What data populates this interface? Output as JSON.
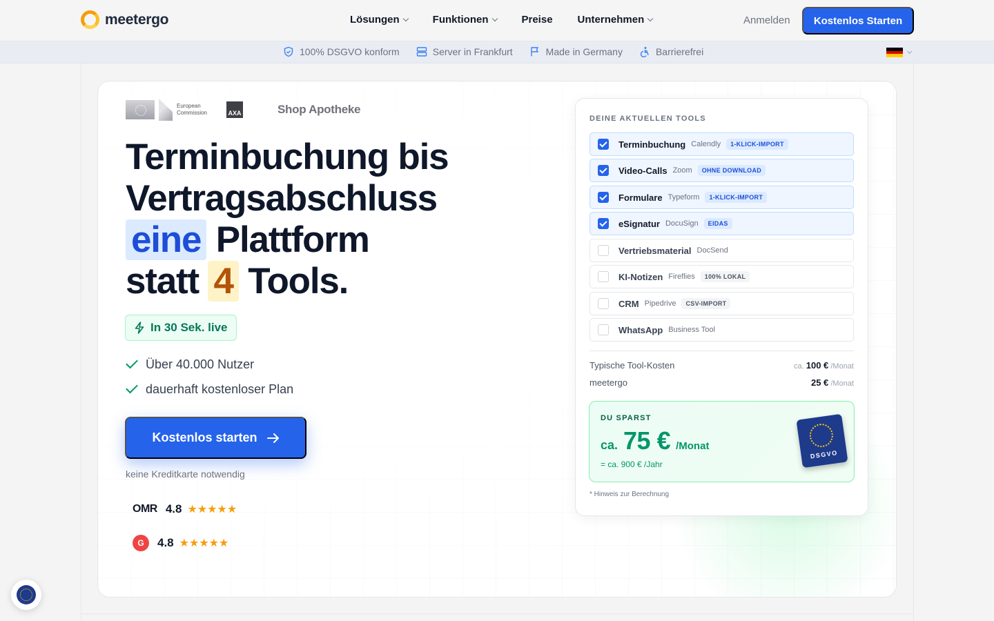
{
  "brand": {
    "name": "meetergo"
  },
  "nav": {
    "items": [
      {
        "label": "Lösungen",
        "has_dropdown": true
      },
      {
        "label": "Funktionen",
        "has_dropdown": true
      },
      {
        "label": "Preise",
        "has_dropdown": false
      },
      {
        "label": "Unternehmen",
        "has_dropdown": true
      }
    ],
    "login_label": "Anmelden",
    "cta_label": "Kostenlos Starten"
  },
  "trust_bar": {
    "items": [
      {
        "label": "100% DSGVO konform",
        "icon": "shield-icon"
      },
      {
        "label": "Server in Frankfurt",
        "icon": "server-icon"
      },
      {
        "label": "Made in Germany",
        "icon": "flag-icon"
      },
      {
        "label": "Barrierefrei",
        "icon": "accessibility-icon"
      }
    ],
    "language_flag": "de",
    "flag_colors": [
      "#000000",
      "#dd0000",
      "#ffce00"
    ]
  },
  "hero": {
    "logos": {
      "ec_line1": "European",
      "ec_line2": "Commission",
      "axa": "AXA",
      "shop": "Shop Apotheke"
    },
    "headline": {
      "line1": "Terminbuchung bis",
      "line2": "Vertragsabschluss",
      "line3_highlight": "eine",
      "line3_rest": "Plattform",
      "line4_start": "statt",
      "line4_highlight": "4",
      "line4_rest": "Tools."
    },
    "live_badge": "In 30 Sek. live",
    "checks": [
      "Über 40.000 Nutzer",
      "dauerhaft kostenloser Plan"
    ],
    "cta_label": "Kostenlos starten",
    "no_credit_card": "keine Kreditkarte notwendig",
    "ratings": [
      {
        "source": "OMR",
        "score": "4.8",
        "stars": "★★★★★"
      },
      {
        "source": "G2",
        "score": "4.8",
        "stars": "★★★★★"
      }
    ]
  },
  "tools_panel": {
    "title": "DEINE AKTUELLEN TOOLS",
    "tools": [
      {
        "name": "Terminbuchung",
        "vendor": "Calendly",
        "badge": "1-KLICK-IMPORT",
        "checked": true
      },
      {
        "name": "Video-Calls",
        "vendor": "Zoom",
        "badge": "OHNE DOWNLOAD",
        "checked": true
      },
      {
        "name": "Formulare",
        "vendor": "Typeform",
        "badge": "1-KLICK-IMPORT",
        "checked": true
      },
      {
        "name": "eSignatur",
        "vendor": "DocuSign",
        "badge": "EIDAS",
        "checked": true
      },
      {
        "name": "Vertriebsmaterial",
        "vendor": "DocSend",
        "badge": "",
        "checked": false
      },
      {
        "name": "KI-Notizen",
        "vendor": "Fireflies",
        "badge": "100% LOKAL",
        "checked": false
      },
      {
        "name": "CRM",
        "vendor": "Pipedrive",
        "badge": "CSV-IMPORT",
        "checked": false
      },
      {
        "name": "WhatsApp",
        "vendor": "Business Tool",
        "badge": "",
        "checked": false
      }
    ],
    "costs": {
      "typical_label": "Typische Tool-Kosten",
      "typical_prefix": "ca.",
      "typical_value": "100 €",
      "typical_unit": "/Monat",
      "meetergo_label": "meetergo",
      "meetergo_value": "25 €",
      "meetergo_unit": "/Monat"
    },
    "savings": {
      "label": "DU SPARST",
      "prefix": "ca.",
      "amount": "75 €",
      "unit": "/Monat",
      "yearly": "= ca. 900 € /Jahr",
      "seal_text": "DSGVO"
    },
    "footnote": "* Hinweis zur Berechnung"
  },
  "colors": {
    "primary": "#2563eb",
    "success": "#059669",
    "amber": "#b45309"
  }
}
